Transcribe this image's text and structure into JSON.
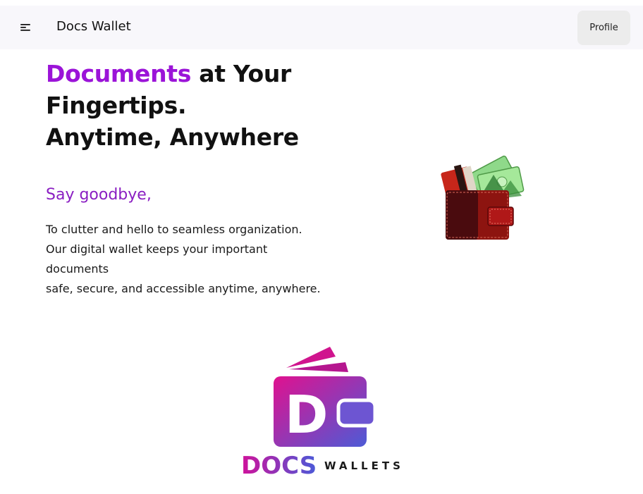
{
  "header": {
    "brand": "Docs Wallet",
    "profile_label": "Profile",
    "menu_icon": "menu-icon"
  },
  "hero": {
    "title_accent": "Documents",
    "title_rest": " at Your Fingertips.",
    "title_line2": "Anytime, Anywhere",
    "subtitle": "Say goodbye,",
    "description_lines": [
      "To clutter and hello to seamless organization.",
      "Our digital wallet keeps your important documents",
      "safe, secure, and accessible anytime, anywhere."
    ]
  },
  "logo": {
    "letter": "D",
    "word_docs": "DOCS",
    "word_wallets": "WALLETS"
  },
  "colors": {
    "accent": "#9b14d8",
    "subtitle": "#8a1ec2",
    "logo_pink": "#d0119a",
    "logo_blue": "#4a5ad8"
  }
}
